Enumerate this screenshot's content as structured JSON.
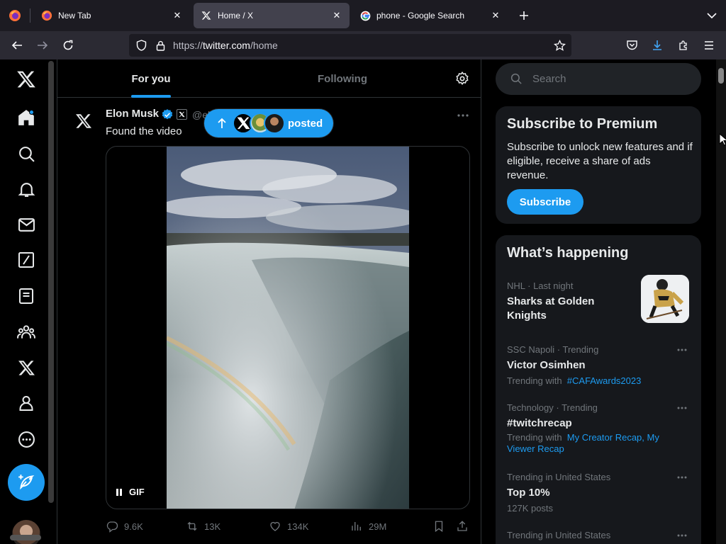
{
  "browser": {
    "tabs": [
      {
        "label": "New Tab",
        "icon": "firefox-icon",
        "active": false
      },
      {
        "label": "Home / X",
        "icon": "x-logo-icon",
        "active": true
      },
      {
        "label": "phone - Google Search",
        "icon": "google-icon",
        "active": false
      }
    ],
    "url": {
      "prefix": "https://",
      "host": "twitter.com",
      "path": "/home"
    }
  },
  "timeline": {
    "tabs": [
      {
        "label": "For you"
      },
      {
        "label": "Following"
      }
    ],
    "pill": {
      "label": "posted"
    }
  },
  "tweet": {
    "author": "Elon Musk",
    "handle": "@el",
    "text": "Found the video",
    "gif_label": "GIF",
    "stats": {
      "replies": "9.6K",
      "reposts": "13K",
      "likes": "134K",
      "views": "29M"
    }
  },
  "sidebar": {
    "search_placeholder": "Search",
    "premium": {
      "title": "Subscribe to Premium",
      "body": "Subscribe to unlock new features and if eligible, receive a share of ads revenue.",
      "button": "Subscribe"
    },
    "happening": {
      "title": "What’s happening",
      "trends": [
        {
          "meta": "NHL · Last night",
          "title": "Sharks at Golden Knights"
        },
        {
          "meta": "SSC Napoli · Trending",
          "title": "Victor Osimhen",
          "sub_prefix": "Trending with",
          "sub_link": "#CAFAwards2023"
        },
        {
          "meta": "Technology · Trending",
          "title": "#twitchrecap",
          "sub_prefix": "Trending with",
          "sub_link": "My Creator Recap, My Viewer Recap"
        },
        {
          "meta": "Trending in United States",
          "title": "Top 10%",
          "sub": "127K posts"
        },
        {
          "meta": "Trending in United States"
        }
      ]
    }
  },
  "colors": {
    "accent": "#1d9bf0",
    "bg": "#000000",
    "card": "#16181c",
    "muted": "#71767b"
  }
}
